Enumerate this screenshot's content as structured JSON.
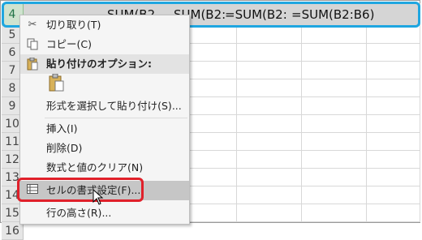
{
  "row_headers": [
    "4",
    "5",
    "6",
    "7",
    "8",
    "9",
    "10",
    "11",
    "12",
    "13",
    "14",
    "15",
    "16",
    "17"
  ],
  "selected_row": {
    "cut_text": "SUM(B2",
    "formula_1": "=SUM(B2:",
    "formula_2": "=SUM(B2:",
    "formula_3": "=SUM(B2:B6)",
    "prefix": "SUM(B2:"
  },
  "menu": {
    "cut": "切り取り(T)",
    "copy": "コピー(C)",
    "paste_options": "貼り付けのオプション:",
    "paste_special": "形式を選択して貼り付け(S)...",
    "insert": "挿入(I)",
    "delete": "削除(D)",
    "clear": "数式と値のクリア(N)",
    "format_cells": "セルの書式設定(F)...",
    "row_height": "行の高さ(R)..."
  },
  "icons": {
    "cut": "scissors-icon",
    "copy": "copy-icon",
    "paste_options": "clipboard-icon",
    "paste_button": "paste-icon",
    "format_cells": "format-cells-icon"
  },
  "colors": {
    "selection_outline": "#1fa6e0",
    "highlight_box": "#e0202a"
  }
}
